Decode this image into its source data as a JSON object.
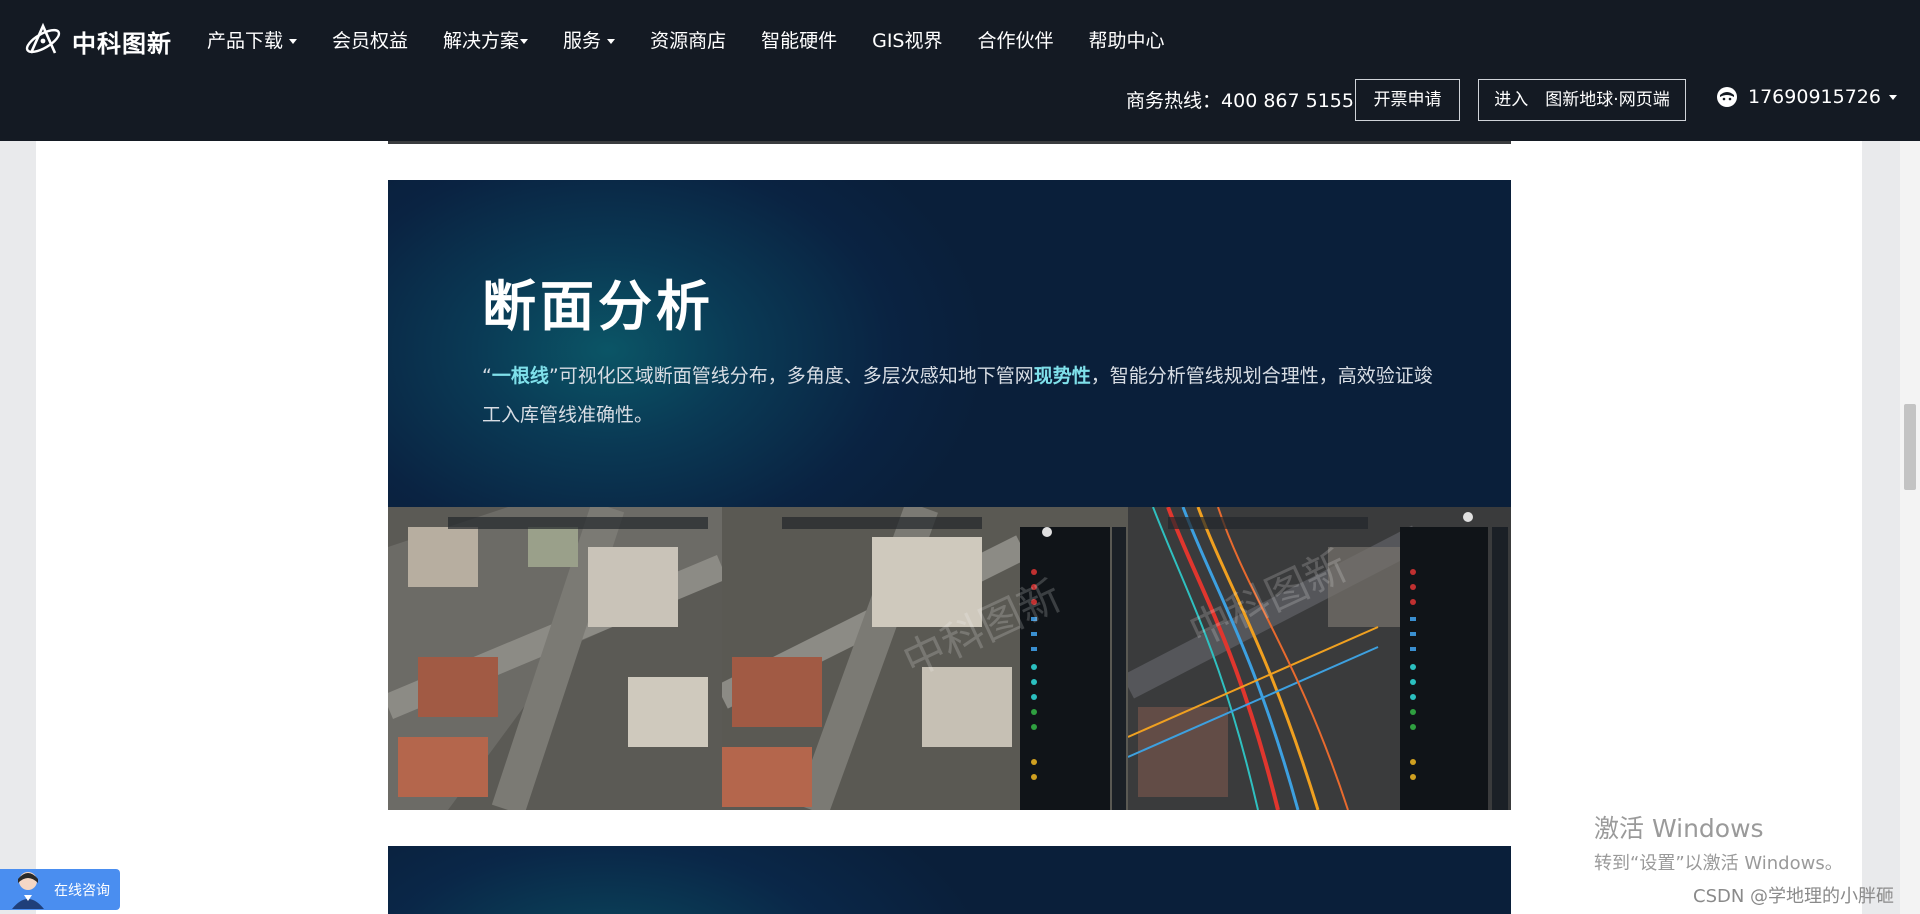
{
  "brand": {
    "name": "中科图新",
    "logo_icon": "atom-logo-icon"
  },
  "nav": {
    "items": [
      {
        "label": "产品下载",
        "dropdown": true
      },
      {
        "label": "会员权益",
        "dropdown": false
      },
      {
        "label": "解决方案",
        "dropdown": true
      },
      {
        "label": "服务",
        "dropdown": true
      },
      {
        "label": "资源商店",
        "dropdown": false
      },
      {
        "label": "智能硬件",
        "dropdown": false
      },
      {
        "label": "GIS视界",
        "dropdown": false
      },
      {
        "label": "合作伙伴",
        "dropdown": false
      },
      {
        "label": "帮助中心",
        "dropdown": false
      }
    ]
  },
  "header": {
    "hotline_label": "商务热线：",
    "hotline_number": "400 867 5155",
    "invoice_button": "开票申请",
    "enter_button": "进入　图新地球·网页端",
    "user_account": "17690915726"
  },
  "feature": {
    "title": "断面分析",
    "desc_q_open": "“",
    "desc_hl1": "一根线",
    "desc_part2": "”可视化区域断面管线分布，多角度、多层次感知地下管网",
    "desc_hl2": "现势性",
    "desc_part3": "，智能分析管线规划合理性，高效验证竣工入库管线准确性。",
    "screenshot_watermark": "中科图新"
  },
  "chat_widget": {
    "label": "在线咨询"
  },
  "os_overlay": {
    "activate_title": "激活 Windows",
    "activate_hint": "转到“设置”以激活 Windows。"
  },
  "page_watermark": "CSDN @学地理的小胖砸",
  "colors": {
    "topbar_bg": "#141a23",
    "card_bg": "#0a2342",
    "highlight": "#7fe0ea",
    "consult_bg": "#4a8ef0"
  }
}
